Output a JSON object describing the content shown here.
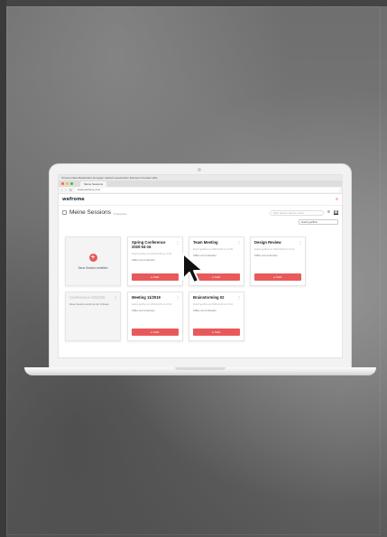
{
  "browser": {
    "menu_bar": "Chrome   Datei   Bearbeiten   Anzeigen   Verlauf   Lesezeichen   Personen   Fenster   Hilfe",
    "tab_label": "Meine Sessions",
    "url": "www.wefrome.com"
  },
  "app": {
    "logo": "wefrome",
    "menu_icon": "menu-icon"
  },
  "page": {
    "title": "Meine Sessions",
    "count": "6 Sessions",
    "search_placeholder": "Nach Session-Namen suchen",
    "sort_label": "Zuletzt geöffnet"
  },
  "cards": [
    {
      "type": "new",
      "label": "Neue Session erstellen"
    },
    {
      "type": "session",
      "title": "Spring Conference 2020-04-16",
      "subtitle": "Zuletzt geöffnet vor 2020-04-08 um 13:46",
      "note": "Offline und vorbereitet",
      "button": "Start"
    },
    {
      "type": "session",
      "title": "Team Meeting",
      "subtitle": "Zuletzt geöffnet vor 2020-04-08 um 13:45",
      "note": "Offline und vorbereitet",
      "button": "Start"
    },
    {
      "type": "session",
      "title": "Design Review",
      "subtitle": "Zuletzt geöffnet vor 2020-04-08 um 13:44",
      "note": "Offline und vorbereitet",
      "button": "Start"
    },
    {
      "type": "archived",
      "title": "Conference 03/2019",
      "note": "Diese Session wurde bei der Vorlesen"
    },
    {
      "type": "session",
      "title": "Meeting 11/2019",
      "subtitle": "Zuletzt geöffnet vor 2020-04-08 um 13:43",
      "note": "Offline und vorbereitet",
      "button": "Start"
    },
    {
      "type": "session",
      "title": "Brainstorming 02",
      "subtitle": "Zuletzt geöffnet vor 2020-04-08 um 13:42",
      "note": "Offline und vorbereitet",
      "button": "Start"
    }
  ],
  "colors": {
    "accent": "#e85a5a",
    "logo": "#1f2a44"
  }
}
